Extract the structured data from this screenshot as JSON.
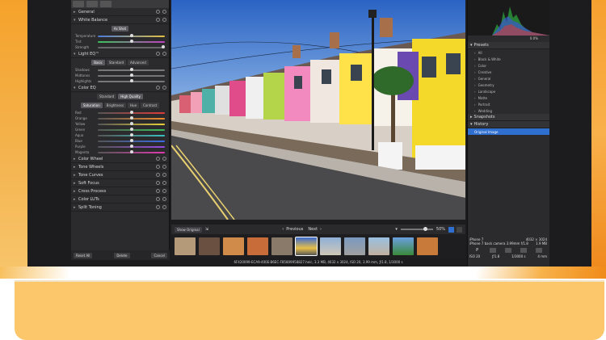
{
  "left_panel": {
    "sections": [
      {
        "label": "General"
      },
      {
        "label": "White Balance"
      }
    ],
    "wb_mode": "As Shot",
    "wb_sliders": [
      {
        "label": "Temperature"
      },
      {
        "label": "Tint"
      },
      {
        "label": "Strength"
      }
    ],
    "light_eq": {
      "label": "Light EQ™",
      "tabs": [
        "Basic",
        "Standard",
        "Advanced"
      ]
    },
    "light_sliders": [
      {
        "label": "Shadows"
      },
      {
        "label": "Midtones"
      },
      {
        "label": "Highlights"
      }
    ],
    "color_eq": {
      "label": "Color EQ",
      "quality": [
        "Standard",
        "High Quality"
      ],
      "tabs": [
        "Saturation",
        "Brightness",
        "Hue",
        "Contrast"
      ],
      "colors": [
        "Red",
        "Orange",
        "Yellow",
        "Green",
        "Aqua",
        "Blue",
        "Purple",
        "Magenta"
      ]
    },
    "bottom_sections": [
      "Color Wheel",
      "Tone Wheels",
      "Tone Curves",
      "Soft Focus",
      "Cross Process",
      "Color LUTs",
      "Split Toning"
    ],
    "footer": {
      "reset": "Reset All",
      "delete": "Delete",
      "cancel": "Cancel"
    }
  },
  "viewbar": {
    "show_original": "Show Original",
    "previous": "Previous",
    "next": "Next",
    "zoom": "50%"
  },
  "status_line": "6F420099-ECA9-400E-B6EC-F85809958827.heic, 3.3 MB, 4032 x 3024, ISO 20, 3.99 mm, ƒ/1.8, 1/3000 s",
  "right_panel": {
    "histogram_value": "0.0%",
    "presets_label": "Presets",
    "presets": [
      "All",
      "Black & White",
      "Color",
      "Creative",
      "General",
      "Geometry",
      "Landscape",
      "Matte",
      "Portrait",
      "Wedding"
    ],
    "snapshots_label": "Snapshots",
    "history_label": "History",
    "history_items": [
      "Original Image"
    ]
  },
  "exif": {
    "camera": "iPhone 7",
    "lens": "iPhone 7 back camera 3.99mm f/1.8",
    "resolution": "4032 × 3024",
    "size": "1.9 MB",
    "icons_label": "P",
    "iso": "ISO 20",
    "aperture": "ƒ/1.8",
    "shutter": "1/3000 s",
    "focal": "4 mm"
  }
}
